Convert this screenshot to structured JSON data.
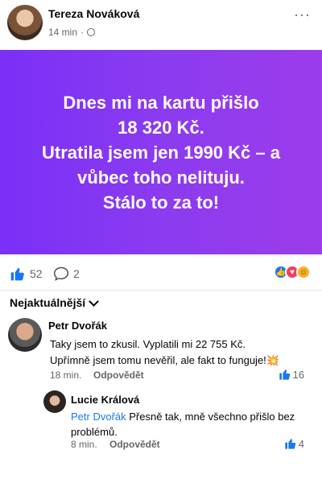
{
  "post": {
    "author": "Tereza Nováková",
    "time": "14 min",
    "privacy_icon": "globe-icon",
    "text_lines": [
      "Dnes mi na kartu přišlo",
      "18 320 Kč.",
      "Utratila jsem jen 1990 Kč – a",
      "vůbec toho nelituju.",
      "Stálo to za to!"
    ],
    "background_colors": [
      "#7b2ff7",
      "#9c3ceb"
    ]
  },
  "stats": {
    "likes": "52",
    "comments": "2"
  },
  "comments_sort": {
    "label": "Nejaktuálnější"
  },
  "comments": [
    {
      "author": "Petr Dvořák",
      "lines": [
        "Taky jsem to zkusil. Vyplatili mi 22 755 Kč.",
        "Upřímně jsem tomu nevěřil, ale fakt to funguje!💥"
      ],
      "time": "18 min.",
      "reply_label": "Odpovědět",
      "likes": "16"
    },
    {
      "author": "Lucie Králová",
      "mention": "Petr Dvořák",
      "text": "Přesně tak, mně všechno přišlo bez problémů.",
      "time": "8 min.",
      "reply_label": "Odpovědět",
      "likes": "4"
    }
  ],
  "colors": {
    "accent": "#1877f2",
    "secondary_text": "#65676b"
  }
}
